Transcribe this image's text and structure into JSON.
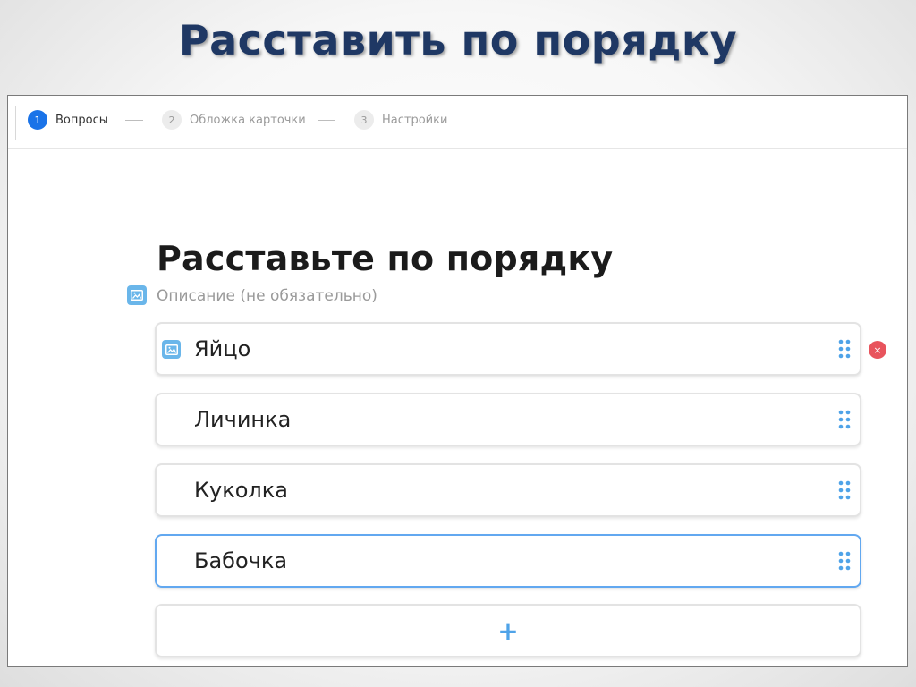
{
  "slide": {
    "title": "Расставить по порядку"
  },
  "stepper": {
    "steps": [
      {
        "num": "1",
        "label": "Вопросы"
      },
      {
        "num": "2",
        "label": "Обложка карточки"
      },
      {
        "num": "3",
        "label": "Настройки"
      }
    ]
  },
  "question": {
    "title": "Расставьте по порядку",
    "description_placeholder": "Описание (не обязательно)"
  },
  "answers": [
    {
      "label": "Яйцо"
    },
    {
      "label": "Личинка"
    },
    {
      "label": "Куколка"
    },
    {
      "label": "Бабочка"
    }
  ],
  "controls": {
    "add_label": "+",
    "remove_label": "×"
  },
  "icons": {
    "image": "image-icon",
    "drag": "drag-handle-icon",
    "remove": "close-icon",
    "add": "plus-icon"
  },
  "colors": {
    "accent": "#1a73e8",
    "icon_blue": "#6ab6ea",
    "handle_blue": "#4fa3e8",
    "remove_red": "#e8545d",
    "slide_title": "#1f3864"
  }
}
